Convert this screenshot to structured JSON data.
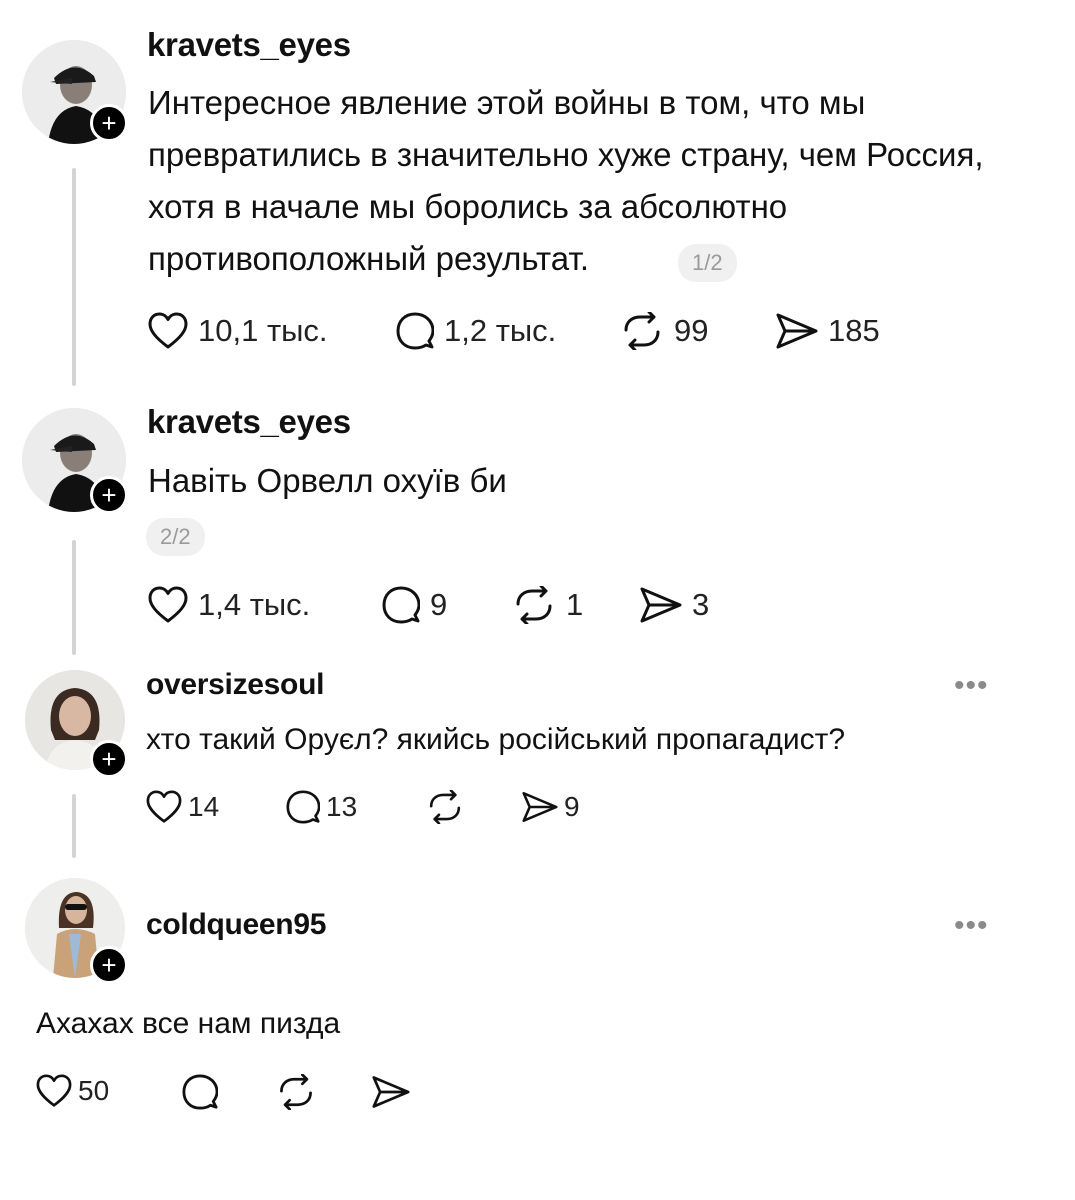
{
  "posts": [
    {
      "username": "kravets_eyes",
      "text": "Интересное явление этой войны в том, что мы превратились в значительно хуже страну, чем Россия, хотя в начале мы боролись за абсолютно противоположный результат.",
      "pager": "1/2",
      "likes": "10,1 тыс.",
      "comments": "1,2 тыс.",
      "reposts": "99",
      "shares": "185"
    },
    {
      "username": "kravets_eyes",
      "text": "Навіть Орвелл охуїв би",
      "pager": "2/2",
      "likes": "1,4 тыс.",
      "comments": "9",
      "reposts": "1",
      "shares": "3"
    },
    {
      "username": "oversizesoul",
      "text": "хто такий Оруєл? якийсь російський пропагадист?",
      "more": "•••",
      "likes": "14",
      "comments": "13",
      "reposts": "",
      "shares": "9"
    },
    {
      "username": "coldqueen95",
      "text": "Ахахах все нам пизда",
      "more": "•••",
      "likes": "50",
      "comments": "",
      "reposts": "",
      "shares": ""
    }
  ],
  "icons": {
    "plus": "+",
    "like": "heart-icon",
    "comment": "comment-bubble-icon",
    "repost": "repost-arrows-icon",
    "share": "send-paper-plane-icon"
  }
}
